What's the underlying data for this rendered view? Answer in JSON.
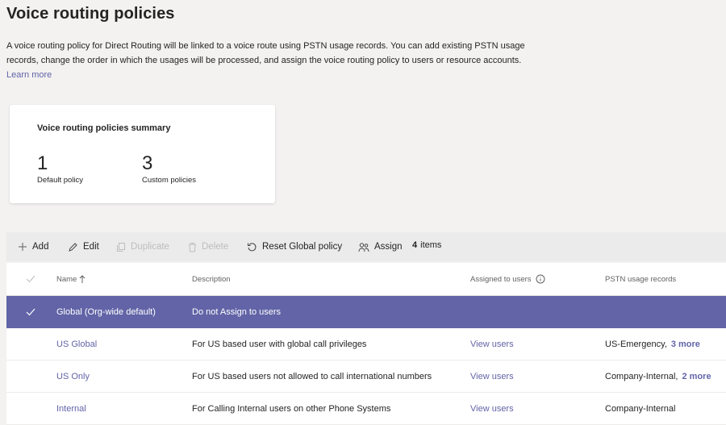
{
  "page": {
    "title": "Voice routing policies",
    "intro": "A voice routing policy for Direct Routing will be linked to a voice route using PSTN usage records. You can add existing PSTN usage records, change the order in which the usages will be processed, and assign the voice routing policy to users or resource accounts.",
    "learn_more": "Learn more"
  },
  "summary": {
    "title": "Voice routing policies summary",
    "default_count": "1",
    "default_label": "Default policy",
    "custom_count": "3",
    "custom_label": "Custom policies"
  },
  "toolbar": {
    "add": "Add",
    "edit": "Edit",
    "duplicate": "Duplicate",
    "delete": "Delete",
    "reset": "Reset Global policy",
    "assign": "Assign",
    "count": "4",
    "count_label": "items"
  },
  "columns": {
    "name": "Name",
    "description": "Description",
    "assigned": "Assigned to users",
    "pstn": "PSTN usage records"
  },
  "rows": [
    {
      "name": "Global (Org-wide default)",
      "description": "Do not Assign to users",
      "assigned": "",
      "pstn": "",
      "more": ""
    },
    {
      "name": "US Global",
      "description": "For US based user with global call privileges",
      "assigned": "View users",
      "pstn": "US-Emergency,",
      "more": "3 more"
    },
    {
      "name": "US Only",
      "description": "For US based users not allowed to call international numbers",
      "assigned": "View users",
      "pstn": "Company-Internal,",
      "more": "2 more"
    },
    {
      "name": "Internal",
      "description": "For Calling Internal users on other Phone Systems",
      "assigned": "View users",
      "pstn": "Company-Internal",
      "more": ""
    }
  ],
  "colors": {
    "accent": "#6264a7",
    "background": "#f3f2f1",
    "toolbar": "#ebebeb",
    "disabled": "#bdbdbd"
  }
}
